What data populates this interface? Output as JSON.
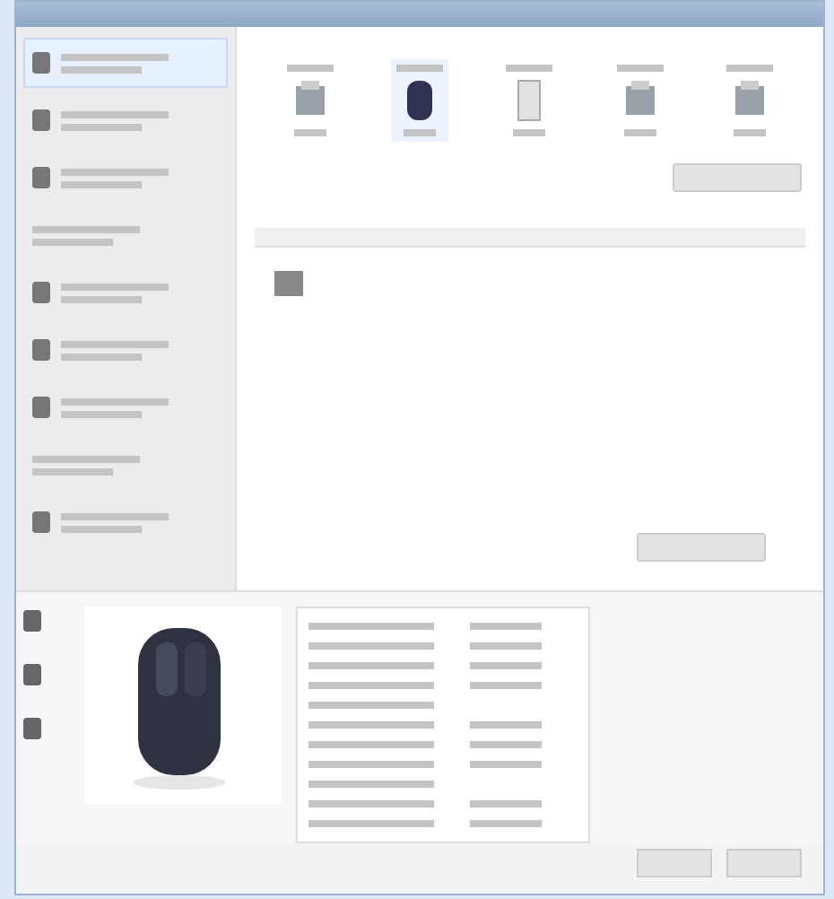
{
  "window": {
    "kind": "dialog"
  },
  "sidebar": {
    "items": [
      {
        "kind": "icon",
        "selected": true
      },
      {
        "kind": "icon",
        "selected": false
      },
      {
        "kind": "icon",
        "selected": false
      },
      {
        "kind": "plain",
        "selected": false
      },
      {
        "kind": "icon",
        "selected": false
      },
      {
        "kind": "icon",
        "selected": false
      },
      {
        "kind": "icon",
        "selected": false
      },
      {
        "kind": "plain",
        "selected": false
      },
      {
        "kind": "icon",
        "selected": false
      }
    ]
  },
  "devices": [
    {
      "kind": "printer",
      "selected": false
    },
    {
      "kind": "mouse",
      "selected": true
    },
    {
      "kind": "tower",
      "selected": false
    },
    {
      "kind": "printer",
      "selected": false
    },
    {
      "kind": "printer",
      "selected": false
    }
  ],
  "properties": {
    "rows": [
      {
        "kind": "pair"
      },
      {
        "kind": "pair"
      },
      {
        "kind": "pair"
      },
      {
        "kind": "pair"
      },
      {
        "kind": "single"
      },
      {
        "kind": "pair"
      },
      {
        "kind": "pair"
      },
      {
        "kind": "pair"
      },
      {
        "kind": "single"
      },
      {
        "kind": "pair"
      },
      {
        "kind": "pair"
      }
    ]
  }
}
